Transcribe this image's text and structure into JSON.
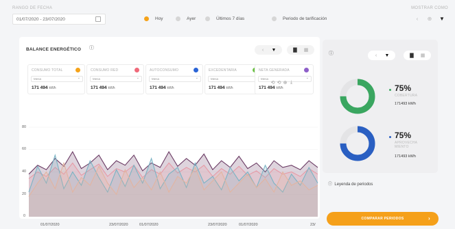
{
  "filters": {
    "date_range_label": "RANGO DE FECHA",
    "date_range_value": "01/07/2020 - 23/07/2020",
    "periods": [
      {
        "label": "Hoy",
        "active": true
      },
      {
        "label": "Ayer",
        "active": false
      },
      {
        "label": "Últimos 7 días",
        "active": false
      },
      {
        "label": "Periodo de tarificación",
        "active": false
      }
    ],
    "show_as_label": "MOSTRAR COMO"
  },
  "balance": {
    "title": "BALANCE ENERGÉTICO",
    "tiles": [
      {
        "name": "CONSUMO TOTAL",
        "color": "#f5a31a",
        "select": "Mesa",
        "value": "171 494",
        "unit": "kWh"
      },
      {
        "name": "CONSUMO RED",
        "color": "#f06a7a",
        "select": "Mesa",
        "value": "171 494",
        "unit": "kWh"
      },
      {
        "name": "AUTOCONSUMO",
        "color": "#2a64d6",
        "select": "Mesa",
        "value": "171 494",
        "unit": "kWh"
      },
      {
        "name": "EXCEDENTARIA",
        "color": "#6fc24a",
        "select": "Mesa",
        "value": "171 494",
        "unit": "kWh"
      },
      {
        "name": "NETA GENERADA",
        "color": "#8e5fc9",
        "select": "Mesa",
        "value": "171 494",
        "unit": "kWh"
      }
    ]
  },
  "chart_data": {
    "type": "area",
    "y_ticks": [
      "80",
      "60",
      "40",
      "20",
      "0"
    ],
    "ylim": [
      0,
      80
    ],
    "x_tick_labels": [
      "01/07/2020",
      "23/07/2020",
      "01/07/2020",
      "23/07/2020",
      "01/07/2020",
      "23/"
    ],
    "series": [
      {
        "color": "#6a3a63",
        "values": [
          38,
          46,
          42,
          52,
          45,
          58,
          43,
          48,
          55,
          42,
          50,
          46,
          55,
          41,
          48,
          44,
          58,
          45,
          52,
          46,
          56,
          42,
          50,
          44,
          54,
          43,
          48,
          40,
          50,
          44,
          46,
          42,
          50,
          44
        ]
      },
      {
        "color": "#e69aa6",
        "values": [
          34,
          40,
          36,
          44,
          38,
          48,
          37,
          42,
          47,
          36,
          43,
          40,
          46,
          35,
          42,
          38,
          48,
          39,
          44,
          40,
          46,
          36,
          43,
          38,
          45,
          37,
          41,
          35,
          43,
          38,
          40,
          36,
          43,
          38
        ]
      },
      {
        "color": "#7ab3c4",
        "values": [
          22,
          45,
          30,
          55,
          25,
          40,
          28,
          50,
          35,
          22,
          42,
          27,
          46,
          30,
          52,
          25,
          38,
          44,
          26,
          48,
          30,
          36,
          24,
          44,
          32,
          40,
          26,
          46,
          30,
          22,
          38,
          28,
          44,
          30
        ]
      },
      {
        "color": "#e2b4a0",
        "values": [
          18,
          30,
          40,
          25,
          48,
          22,
          35,
          28,
          45,
          30,
          20,
          42,
          26,
          35,
          24,
          40,
          22,
          36,
          30,
          44,
          24,
          32,
          40,
          22,
          30,
          38,
          26,
          34,
          22,
          40,
          28,
          32,
          24,
          28
        ]
      }
    ]
  },
  "side": {
    "coverage": {
      "percent": "75%",
      "label": "COBERTURA",
      "value": 0.75,
      "kwh": "171493 kWh",
      "color": "#3aa660"
    },
    "usage": {
      "percent": "75%",
      "label_line1": "APROVECHA",
      "label_line2": "MIENTO",
      "value": 0.75,
      "kwh": "171493 kWh",
      "color": "#2a5fc2"
    },
    "legend_link": "Leyenda de periodos"
  },
  "cta": {
    "label": "COMPARAR PERIODOS"
  },
  "icons": {
    "arrow": "›",
    "bar_chart": "▇",
    "table": "▦",
    "chevron_left": "‹",
    "arrow_down": "▼",
    "reset": "⟲",
    "zoom_in": "⊕",
    "download": "⤓"
  }
}
